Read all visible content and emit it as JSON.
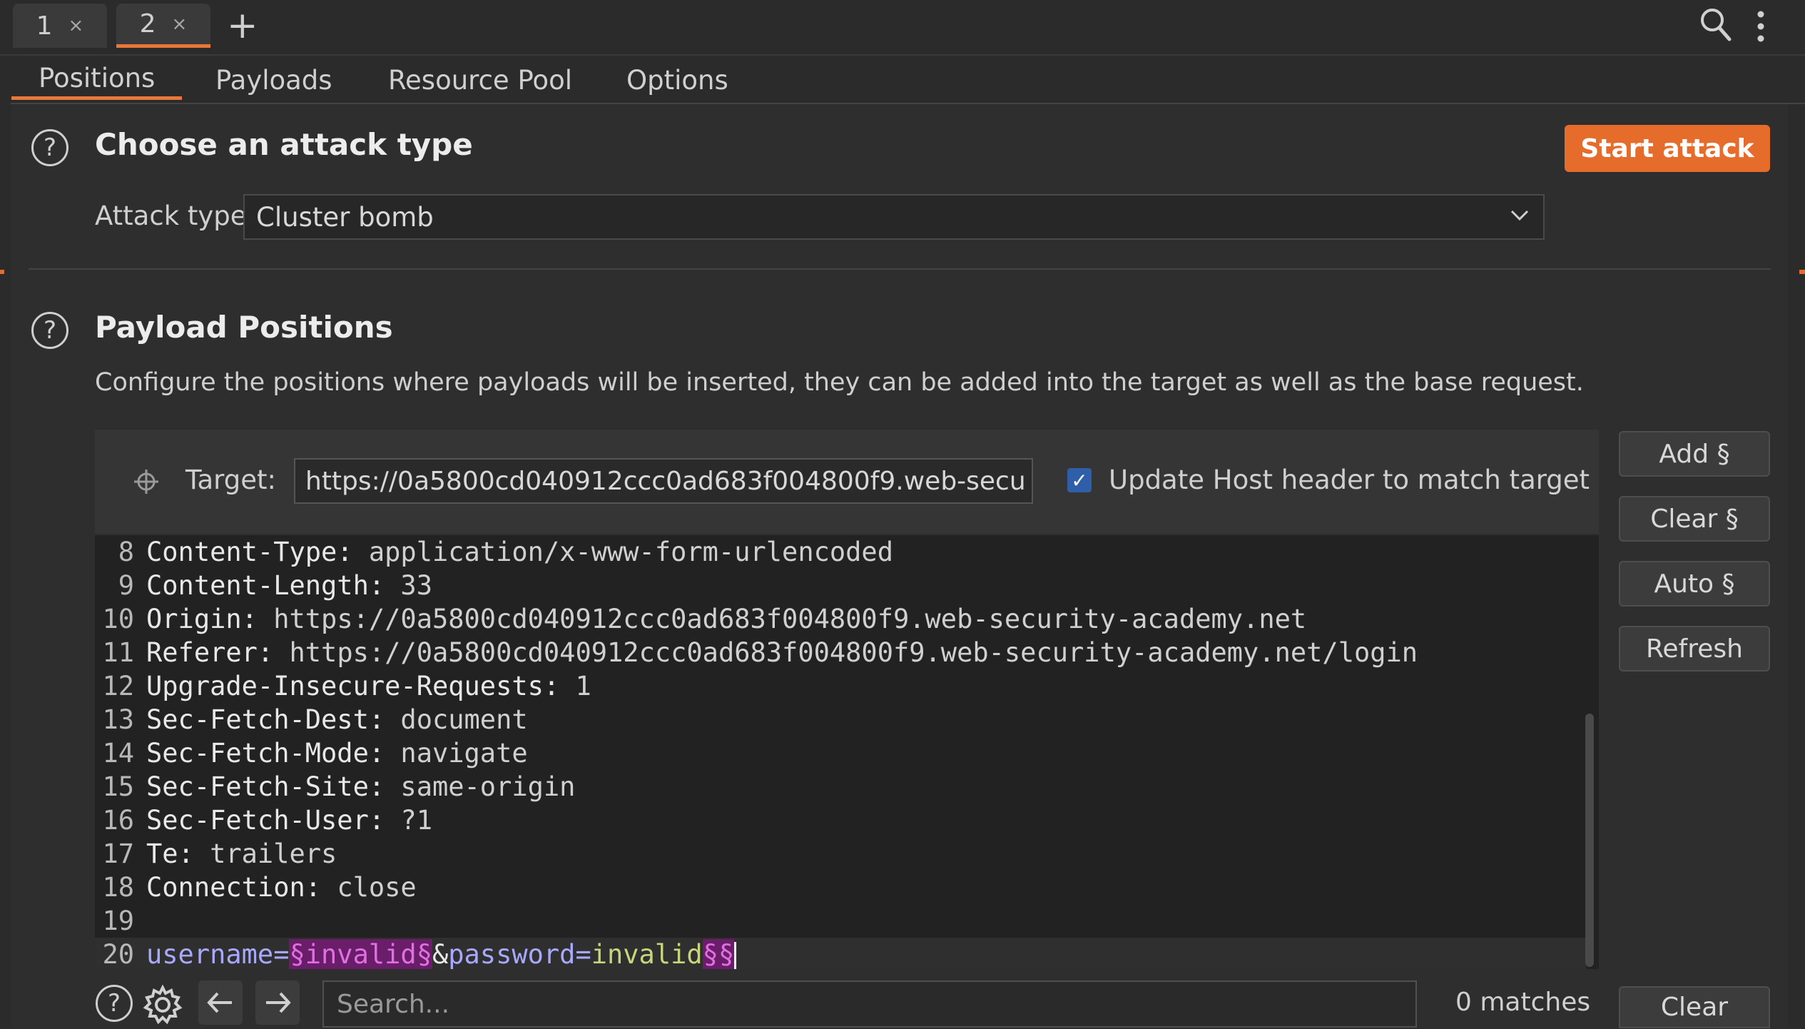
{
  "request_tabs": [
    {
      "label": "1",
      "close": "×"
    },
    {
      "label": "2",
      "close": "×"
    }
  ],
  "new_tab_label": "+",
  "sub_tabs": [
    "Positions",
    "Payloads",
    "Resource Pool",
    "Options"
  ],
  "attack_type_section": {
    "help": "?",
    "title": "Choose an attack type",
    "start_button": "Start attack",
    "attack_type_label": "Attack type:",
    "attack_type_value": "Cluster bomb"
  },
  "payload_positions": {
    "help": "?",
    "title": "Payload Positions",
    "description": "Configure the positions where payloads will be inserted, they can be added into the target as well as the base request.",
    "target_label": "Target:",
    "target_value": "https://0a5800cd040912ccc0ad683f004800f9.web-secu",
    "update_host_checked": true,
    "update_host_label": "Update Host header to match target"
  },
  "side_buttons": [
    "Add §",
    "Clear §",
    "Auto §",
    "Refresh"
  ],
  "editor_lines": [
    {
      "num": "8",
      "name": "Content-Type:",
      "value": " application/x-www-form-urlencoded"
    },
    {
      "num": "9",
      "name": "Content-Length:",
      "value": " 33"
    },
    {
      "num": "10",
      "name": "Origin:",
      "value": " https://0a5800cd040912ccc0ad683f004800f9.web-security-academy.net"
    },
    {
      "num": "11",
      "name": "Referer:",
      "value": " https://0a5800cd040912ccc0ad683f004800f9.web-security-academy.net/login"
    },
    {
      "num": "12",
      "name": "Upgrade-Insecure-Requests:",
      "value": " 1"
    },
    {
      "num": "13",
      "name": "Sec-Fetch-Dest:",
      "value": " document"
    },
    {
      "num": "14",
      "name": "Sec-Fetch-Mode:",
      "value": " navigate"
    },
    {
      "num": "15",
      "name": "Sec-Fetch-Site:",
      "value": " same-origin"
    },
    {
      "num": "16",
      "name": "Sec-Fetch-User:",
      "value": " ?1"
    },
    {
      "num": "17",
      "name": "Te:",
      "value": " trailers"
    },
    {
      "num": "18",
      "name": "Connection:",
      "value": " close"
    },
    {
      "num": "19",
      "name": "",
      "value": ""
    }
  ],
  "body_line": {
    "num": "20",
    "p1_name": "username=",
    "p1_marked": "§invalid§",
    "amp": "&",
    "p2_name": "password=",
    "p2_value": "invalid",
    "p2_marked": "§§"
  },
  "bottom_bar": {
    "search_placeholder": "Search...",
    "matches": "0 matches",
    "clear_button": "Clear"
  },
  "colors": {
    "accent": "#e66c2c",
    "background": "#2b2b2b",
    "marker": "#6a1e6a"
  }
}
